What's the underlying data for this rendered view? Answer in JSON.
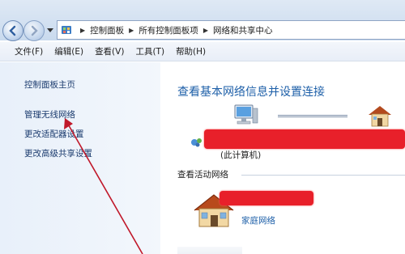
{
  "address_bar": {
    "breadcrumbs": [
      "控制面板",
      "所有控制面板项",
      "网络和共享中心"
    ]
  },
  "menubar": {
    "items": [
      "文件(F)",
      "编辑(E)",
      "查看(V)",
      "工具(T)",
      "帮助(H)"
    ]
  },
  "sidebar": {
    "links": [
      "控制面板主页",
      "管理无线网络",
      "更改适配器设置",
      "更改高级共享设置"
    ]
  },
  "main": {
    "title": "查看基本网络信息并设置连接",
    "this_pc_label": "(此计算机)",
    "active_networks_heading": "查看活动网络",
    "network_type_label": "家庭网络"
  },
  "colors": {
    "link_blue": "#1d5fa8",
    "redaction_red": "#e8202a",
    "annotation_arrow": "#c0182a"
  },
  "icons": [
    "back-arrow-icon",
    "forward-arrow-icon",
    "control-panel-icon",
    "computer-icon",
    "home-network-icon",
    "network-small-icon"
  ]
}
